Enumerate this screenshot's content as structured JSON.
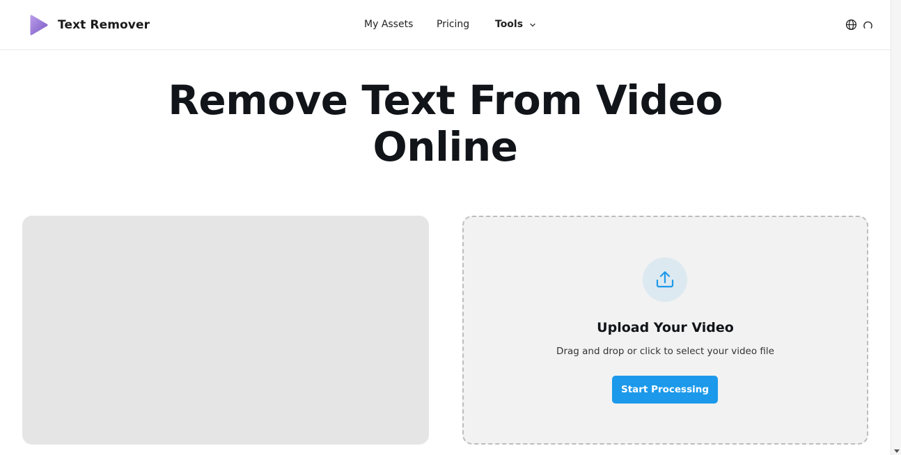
{
  "brand": {
    "name": "Text Remover",
    "logo_icon": "play-triangle-logo",
    "logo_color": "#9b7bd8"
  },
  "nav": {
    "items": [
      {
        "label": "My Assets"
      },
      {
        "label": "Pricing"
      },
      {
        "label": "Tools",
        "dropdown": true
      }
    ]
  },
  "header_icons": {
    "language": "globe-icon",
    "status": "loading-spinner-icon"
  },
  "hero": {
    "title_line1": "Remove Text From Video",
    "title_line2": "Online"
  },
  "upload": {
    "icon": "upload-icon",
    "title": "Upload Your Video",
    "description": "Drag and drop or click to select your video file",
    "button_label": "Start Processing",
    "accent_color": "#1c99ea"
  }
}
